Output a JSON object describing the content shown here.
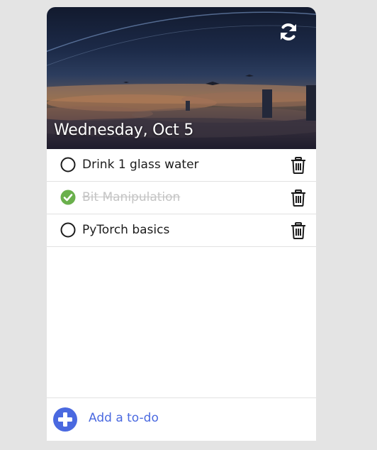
{
  "header": {
    "date": "Wednesday, Oct 5"
  },
  "todos": [
    {
      "text": "Drink 1 glass water",
      "completed": false
    },
    {
      "text": "Bit Manipulation",
      "completed": true
    },
    {
      "text": "PyTorch basics",
      "completed": false
    }
  ],
  "footer": {
    "add_label": "Add a to-do"
  },
  "icons": {
    "refresh": "refresh-icon",
    "unchecked": "circle-outline-icon",
    "checked": "check-circle-icon",
    "delete": "trash-icon",
    "add": "plus-circle-icon"
  },
  "colors": {
    "accent": "#4a69e0",
    "done_check": "#6ab04c",
    "done_text": "#c4c4c4"
  }
}
